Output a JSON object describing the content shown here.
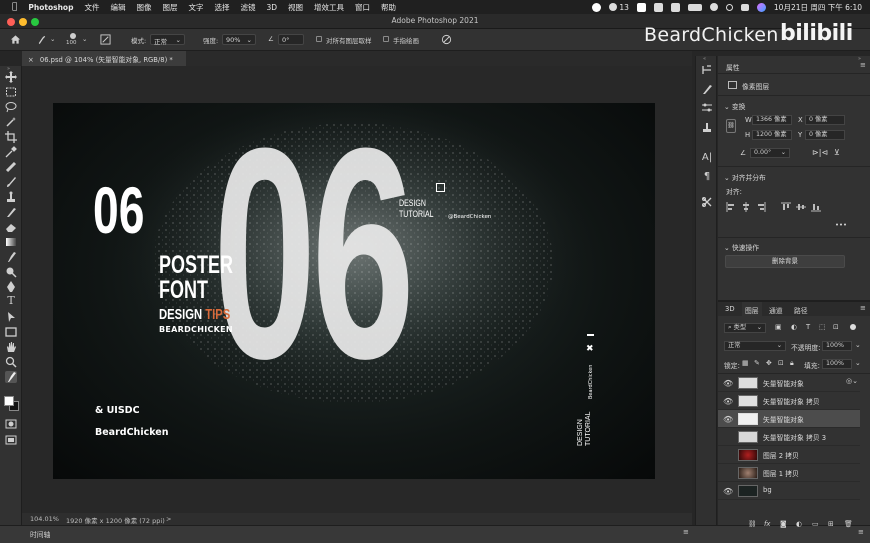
{
  "menubar": {
    "app": "Photoshop",
    "items": [
      "文件",
      "编辑",
      "图像",
      "图层",
      "文字",
      "选择",
      "滤镜",
      "3D",
      "视图",
      "增效工具",
      "窗口",
      "帮助"
    ],
    "notification_count": "13",
    "clock": "10月21日 周四 下午 6:10"
  },
  "window": {
    "title": "Adobe Photoshop 2021"
  },
  "watermark": {
    "text": "BeardChicken",
    "logo": "bilibili"
  },
  "options": {
    "brush_size": "100",
    "mode_label": "模式:",
    "mode_value": "正常",
    "strength_label": "强度:",
    "strength_value": "90%",
    "angle_value": "0°",
    "sample_all_label": "对所有图层取样",
    "finger_paint_label": "手指绘画"
  },
  "document": {
    "tab": "06.psd @ 104% (矢量智能对象, RGB/8) *"
  },
  "poster": {
    "big_number": "06",
    "small_number": "06",
    "line1": "POSTER",
    "line2": "FONT",
    "design": "DESIGN",
    "tips": "TIPS",
    "author_small": "BEARDCHICKEN",
    "uisdc": "& UISDC",
    "beardchicken": "BeardChicken",
    "design_tutorial_1": "DESIGN",
    "design_tutorial_2": "TUTORIAL",
    "handle": "@BeardChicken",
    "vertical_name": "BeardChicken",
    "vertical_design": "DESIGN",
    "vertical_tutorial": "TUTORIAL",
    "mark": "✖"
  },
  "status": {
    "zoom": "104.01%",
    "info": "1920 像素 x 1200 像素 (72 ppi)",
    "arrow": ">"
  },
  "timeline": {
    "label": "时间轴"
  },
  "properties": {
    "header": "属性",
    "layer_type": "像素图层",
    "transform_header": "变换",
    "w_label": "W",
    "w_value": "1366 像素",
    "x_label": "X",
    "x_value": "0 像素",
    "h_label": "H",
    "h_value": "1200 像素",
    "y_label": "Y",
    "y_value": "0 像素",
    "angle_value": "0.00°",
    "align_header": "对齐并分布",
    "align_label": "对齐:",
    "more": "•••",
    "quick_header": "快速操作",
    "remove_bg": "删除背景"
  },
  "layers_panel": {
    "tabs": [
      "3D",
      "图层",
      "通道",
      "路径"
    ],
    "kind_label": "类型",
    "blend_mode": "正常",
    "opacity_label": "不透明度:",
    "opacity_value": "100%",
    "lock_label": "锁定:",
    "fill_label": "填充:",
    "fill_value": "100%",
    "layers": [
      {
        "name": "矢量智能对象",
        "visible": true
      },
      {
        "name": "矢量智能对象 拷贝",
        "visible": true
      },
      {
        "name": "矢量智能对象",
        "visible": true
      },
      {
        "name": "矢量智能对象 拷贝 3",
        "visible": false
      },
      {
        "name": "图层 2 拷贝",
        "visible": false
      },
      {
        "name": "图层 1 拷贝",
        "visible": false
      },
      {
        "name": "bg",
        "visible": true
      }
    ],
    "footer_icons": [
      "link-icon",
      "fx-icon",
      "mask-icon",
      "adjustment-icon",
      "folder-icon",
      "new-layer-icon",
      "trash-icon"
    ],
    "fx_label": "fx"
  },
  "colors": {
    "accent_orange": "#d86a3a",
    "panel_bg": "#323232",
    "canvas_bg": "#282828"
  }
}
